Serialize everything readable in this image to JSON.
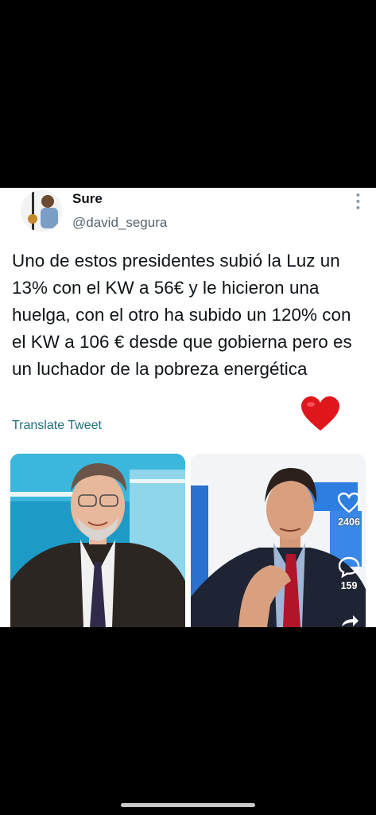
{
  "tweet": {
    "display_name": "Sure",
    "handle": "@david_segura",
    "text": "Uno de estos presidentes subió la Luz un 13%  con el KW a 56€ y le hicieron una huelga, con el otro ha  subido un 120%  con el KW a 106 € desde que gobierna pero es un luchador de la pobreza energética",
    "translate_label": "Translate Tweet"
  },
  "overlay": {
    "likes": "2406",
    "comments": "159",
    "icons": [
      "heart-outline-icon",
      "comment-icon",
      "share-arrow-icon"
    ]
  },
  "colors": {
    "link": "#1e6f7c",
    "heart": "#e0161d",
    "background": "#000000"
  }
}
